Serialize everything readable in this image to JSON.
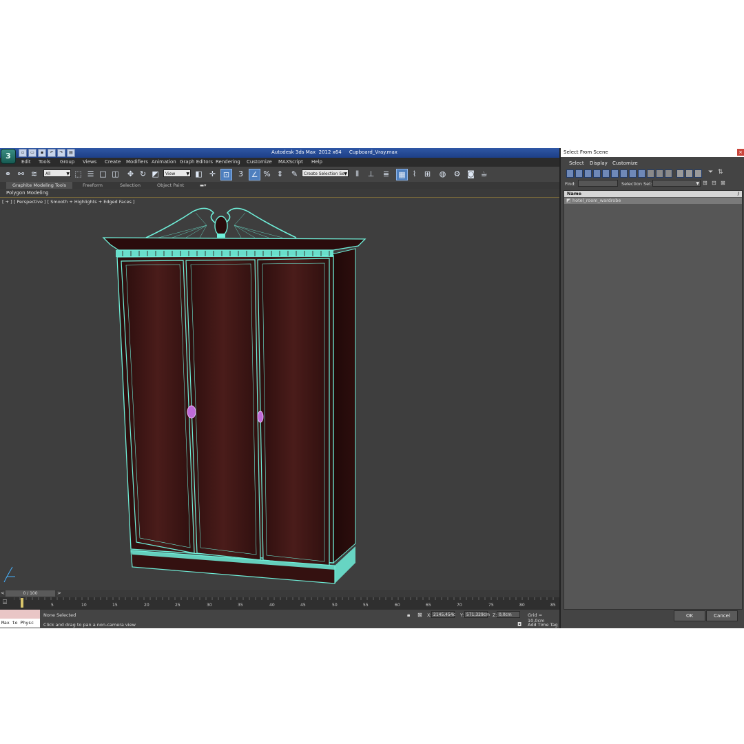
{
  "app": {
    "title": "Autodesk 3ds Max  2012 x64     Cupboard_Vray.max",
    "logo": "3"
  },
  "menu": [
    "Edit",
    "Tools",
    "Group",
    "Views",
    "Create",
    "Modifiers",
    "Animation",
    "Graph Editors",
    "Rendering",
    "Customize",
    "MAXScript",
    "Help"
  ],
  "toolbar": {
    "filter_value": "All",
    "coord_value": "View",
    "selection_set_placeholder": "Create Selection Se",
    "snaps": [
      "3",
      "2.5",
      "%"
    ]
  },
  "ribbon": {
    "tabs": [
      "Graphite Modeling Tools",
      "Freeform",
      "Selection",
      "Object Paint"
    ],
    "panel_label": "Polygon Modeling"
  },
  "viewport": {
    "label": "[ + ] [ Perspective ] [ Smooth + Highlights + Edged Faces ]"
  },
  "timeline": {
    "slider_text": "0 / 100",
    "ticks": [
      "5",
      "10",
      "15",
      "20",
      "25",
      "30",
      "35",
      "40",
      "45",
      "50",
      "55",
      "60",
      "65",
      "70",
      "75",
      "80",
      "85"
    ]
  },
  "status": {
    "maxscript_text": "Max to Physc",
    "selection": "None Selected",
    "prompt": "Click and drag to pan a non-camera view",
    "x_label": "X:",
    "x_value": "2145,454c",
    "y_label": "Y:",
    "y_value": "571,329cm",
    "z_label": "Z:",
    "z_value": "0,0cm",
    "grid": "Grid = 10,0cm",
    "add_time_tag": "Add Time Tag"
  },
  "panel": {
    "title": "Select From Scene",
    "menu": [
      "Select",
      "Display",
      "Customize"
    ],
    "find_label": "Find:",
    "selection_set_label": "Selection Set:",
    "column_header": "Name",
    "items": [
      "hotel_room_wardrobe"
    ],
    "ok_label": "OK",
    "cancel_label": "Cancel"
  },
  "colors": {
    "wire": "#6ff0da",
    "wood": "#3a1414",
    "handle": "#c06ad8"
  }
}
